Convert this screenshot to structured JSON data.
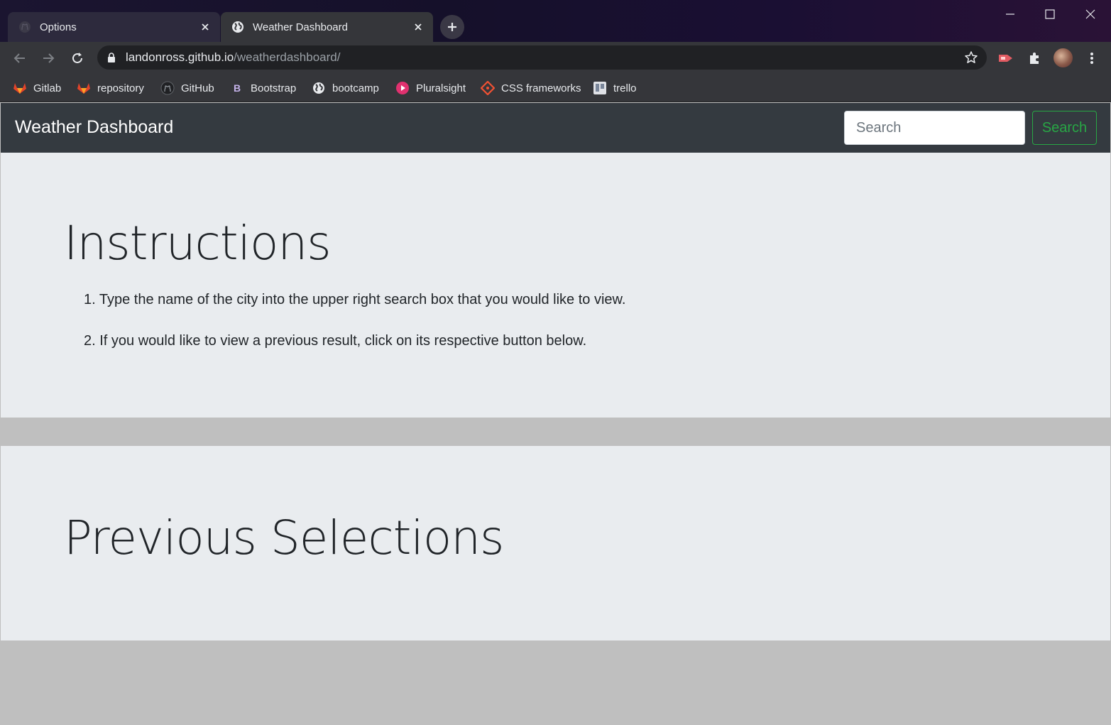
{
  "browser": {
    "tabs": [
      {
        "title": "Options",
        "active": false,
        "favicon": "github-icon"
      },
      {
        "title": "Weather Dashboard",
        "active": true,
        "favicon": "globe-icon"
      }
    ],
    "url_host": "landonross.github.io",
    "url_path": "/weatherdashboard/",
    "bookmarks": [
      {
        "label": "Gitlab",
        "icon": "gitlab-icon"
      },
      {
        "label": "repository",
        "icon": "gitlab-icon"
      },
      {
        "label": "GitHub",
        "icon": "github-icon"
      },
      {
        "label": "Bootstrap",
        "icon": "bootstrap-icon"
      },
      {
        "label": "bootcamp",
        "icon": "globe-icon"
      },
      {
        "label": "Pluralsight",
        "icon": "pluralsight-icon"
      },
      {
        "label": "CSS frameworks",
        "icon": "git-icon"
      },
      {
        "label": "trello",
        "icon": "trello-icon"
      }
    ]
  },
  "navbar": {
    "brand": "Weather Dashboard",
    "search_placeholder": "Search",
    "search_button": "Search"
  },
  "instructions": {
    "heading": "Instructions",
    "steps": [
      "1. Type the name of the city into the upper right search box that you would like to view.",
      "2. If you would like to view a previous result, click on its respective button below."
    ]
  },
  "previous": {
    "heading": "Previous Selections"
  },
  "colors": {
    "navbar_bg": "#343a40",
    "jumbotron_bg": "#e9ecef",
    "page_bg": "#bfbfbf",
    "success": "#28a745"
  }
}
